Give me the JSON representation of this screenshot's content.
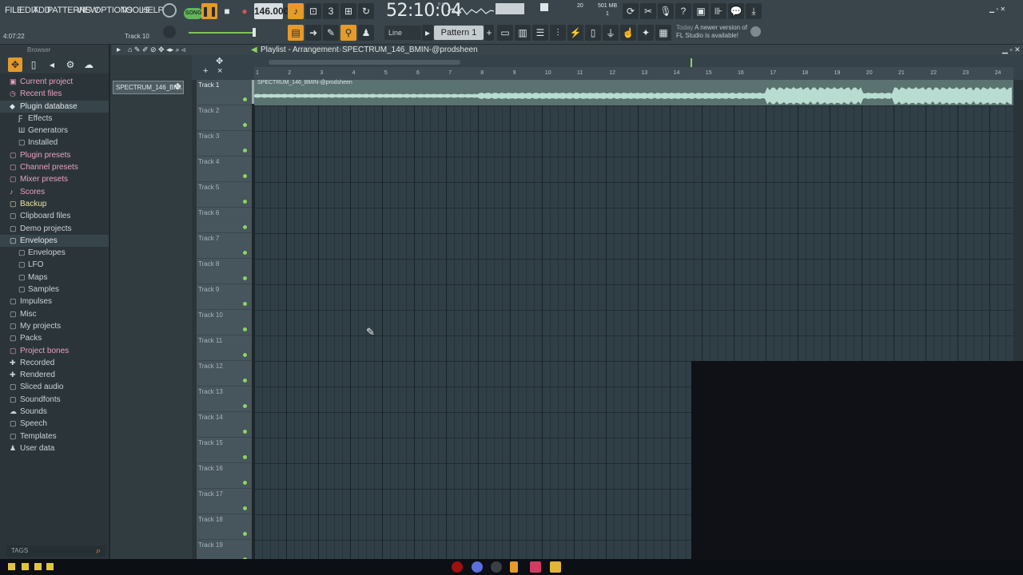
{
  "menu": [
    "FILE",
    "EDIT",
    "ADD",
    "PATTERNS",
    "VIEW",
    "OPTIONS",
    "TOOLS",
    "HELP"
  ],
  "transport": {
    "song_label": "SONG",
    "tempo": "146.000",
    "clock": "52:10:04",
    "clock_suffix": "B:S:T"
  },
  "status": {
    "time_hint": "4:07:22",
    "track_hint": "Track 10",
    "cpu": "20",
    "memory": "501 MB",
    "voices": "1"
  },
  "snap": {
    "mode": "Line",
    "pattern": "Pattern 1"
  },
  "update_notice": {
    "line1": "Today",
    "line2": "A newer version of",
    "line3": "FL Studio is available!"
  },
  "browser": {
    "title": "Browser",
    "items": [
      {
        "label": "Current project",
        "icon": "project-icon",
        "color": "#e8a0c0",
        "sub": false
      },
      {
        "label": "Recent files",
        "icon": "clock-icon",
        "color": "#e8a0c0",
        "sub": false
      },
      {
        "label": "Plugin database",
        "icon": "plug-icon",
        "color": "#dfe6e8",
        "sub": false,
        "hl": true
      },
      {
        "label": "Effects",
        "icon": "fx-icon",
        "color": "#c9d3d6",
        "sub": true
      },
      {
        "label": "Generators",
        "icon": "generator-icon",
        "color": "#c9d3d6",
        "sub": true
      },
      {
        "label": "Installed",
        "icon": "folder-icon",
        "color": "#c9d3d6",
        "sub": true
      },
      {
        "label": "Plugin presets",
        "icon": "preset-icon",
        "color": "#e8a0c0",
        "sub": false
      },
      {
        "label": "Channel presets",
        "icon": "preset-icon",
        "color": "#e8a0c0",
        "sub": false
      },
      {
        "label": "Mixer presets",
        "icon": "preset-icon",
        "color": "#e8a0c0",
        "sub": false
      },
      {
        "label": "Scores",
        "icon": "note-icon",
        "color": "#e8a0c0",
        "sub": false
      },
      {
        "label": "Backup",
        "icon": "folder-icon",
        "color": "#e9e2a0",
        "sub": false
      },
      {
        "label": "Clipboard files",
        "icon": "folder-icon",
        "color": "#c9d3d6",
        "sub": false
      },
      {
        "label": "Demo projects",
        "icon": "folder-icon",
        "color": "#c9d3d6",
        "sub": false
      },
      {
        "label": "Envelopes",
        "icon": "folder-icon",
        "color": "#dfe6e8",
        "sub": false,
        "hl": true
      },
      {
        "label": "Envelopes",
        "icon": "folder-icon",
        "color": "#c9d3d6",
        "sub": true
      },
      {
        "label": "LFO",
        "icon": "folder-icon",
        "color": "#c9d3d6",
        "sub": true
      },
      {
        "label": "Maps",
        "icon": "folder-icon",
        "color": "#c9d3d6",
        "sub": true
      },
      {
        "label": "Samples",
        "icon": "folder-icon",
        "color": "#c9d3d6",
        "sub": true
      },
      {
        "label": "Impulses",
        "icon": "folder-icon",
        "color": "#c9d3d6",
        "sub": false
      },
      {
        "label": "Misc",
        "icon": "folder-icon",
        "color": "#c9d3d6",
        "sub": false
      },
      {
        "label": "My projects",
        "icon": "folder-icon",
        "color": "#c9d3d6",
        "sub": false
      },
      {
        "label": "Packs",
        "icon": "folder-icon",
        "color": "#c9d3d6",
        "sub": false
      },
      {
        "label": "Project bones",
        "icon": "folder-icon",
        "color": "#e8a0c0",
        "sub": false
      },
      {
        "label": "Recorded",
        "icon": "plus-icon",
        "color": "#c9d3d6",
        "sub": false
      },
      {
        "label": "Rendered",
        "icon": "plus-icon",
        "color": "#c9d3d6",
        "sub": false
      },
      {
        "label": "Sliced audio",
        "icon": "folder-icon",
        "color": "#c9d3d6",
        "sub": false
      },
      {
        "label": "Soundfonts",
        "icon": "folder-icon",
        "color": "#c9d3d6",
        "sub": false
      },
      {
        "label": "Sounds",
        "icon": "cloud-icon",
        "color": "#c9d3d6",
        "sub": false
      },
      {
        "label": "Speech",
        "icon": "folder-icon",
        "color": "#c9d3d6",
        "sub": false
      },
      {
        "label": "Templates",
        "icon": "folder-icon",
        "color": "#c9d3d6",
        "sub": false
      },
      {
        "label": "User data",
        "icon": "user-icon",
        "color": "#c9d3d6",
        "sub": false
      }
    ],
    "tags_label": "TAGS"
  },
  "channel": {
    "name": "SPECTRUM_146_BMI..."
  },
  "playlist": {
    "title": "Playlist - Arrangement",
    "pattern_name": "SPECTRUM_146_BMIN-@prodsheen",
    "clip_label": "SPECTRUM_146_BMIN-@prodsheen",
    "bars": [
      "1",
      "2",
      "3",
      "4",
      "5",
      "6",
      "7",
      "8",
      "9",
      "10",
      "11",
      "12",
      "13",
      "14",
      "15",
      "16",
      "17",
      "18",
      "19",
      "20",
      "21",
      "22",
      "23",
      "24"
    ],
    "tracks": [
      "Track 1",
      "Track 2",
      "Track 3",
      "Track 4",
      "Track 5",
      "Track 6",
      "Track 7",
      "Track 8",
      "Track 9",
      "Track 10",
      "Track 11",
      "Track 12",
      "Track 13",
      "Track 14",
      "Track 15",
      "Track 16",
      "Track 17",
      "Track 18",
      "Track 19"
    ]
  },
  "colors": {
    "accent": "#e59a2a",
    "clip": "#5a7270",
    "wave": "#b9dcd0",
    "led": "#8ed35f"
  }
}
